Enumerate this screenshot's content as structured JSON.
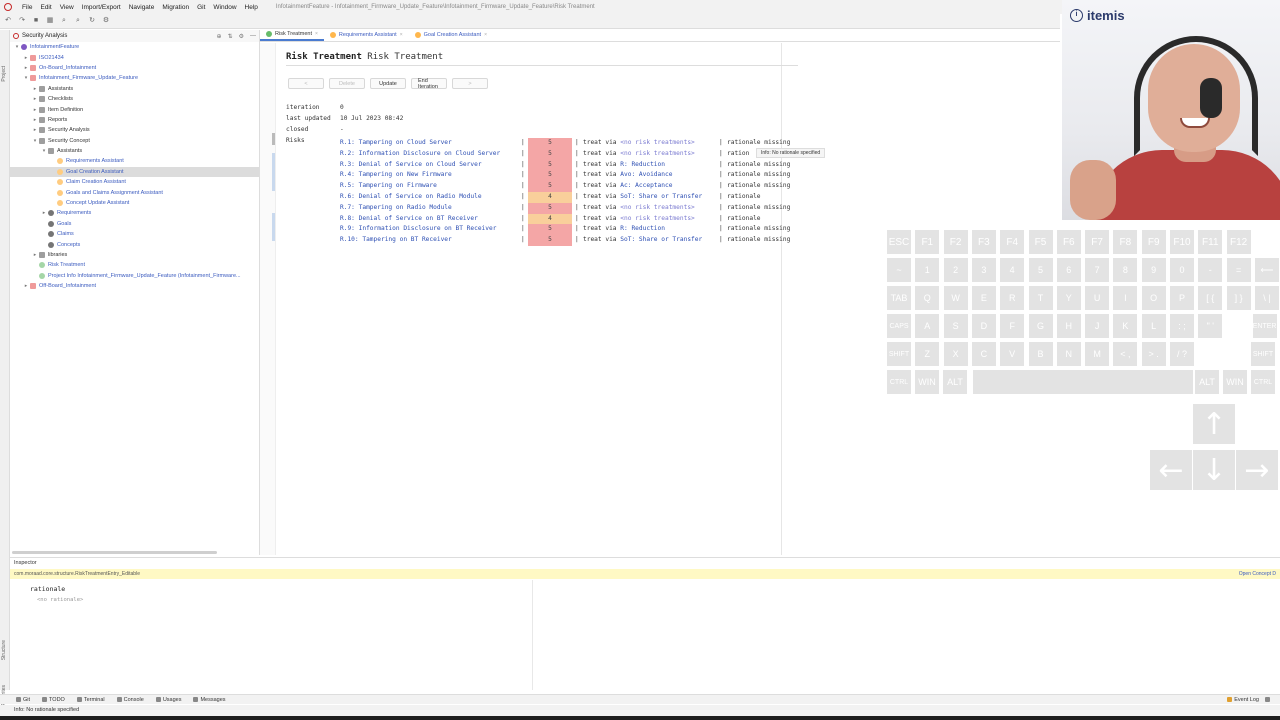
{
  "menu": {
    "items": [
      "File",
      "Edit",
      "View",
      "Import/Export",
      "Navigate",
      "Migration",
      "Git",
      "Window",
      "Help"
    ],
    "window_title": "InfotainmentFeature - Infotainment_Firmware_Update_Feature\\Infotainment_Firmware_Update_Feature\\Risk Treatment"
  },
  "project_panel": {
    "title": "Security Analysis",
    "tree": [
      {
        "label": "InfotainmentFeature",
        "depth": 0,
        "arrow": "▾",
        "icon": "model"
      },
      {
        "label": "ISO21434",
        "depth": 1,
        "arrow": "▸",
        "icon": "s"
      },
      {
        "label": "On-Board_Infotainment",
        "depth": 1,
        "arrow": "▸",
        "icon": "s"
      },
      {
        "label": "Infotainment_Firmware_Update_Feature",
        "depth": 1,
        "arrow": "▾",
        "icon": "s"
      },
      {
        "label": "Assistants",
        "depth": 2,
        "arrow": "▸",
        "icon": "folder"
      },
      {
        "label": "Checklists",
        "depth": 2,
        "arrow": "▸",
        "icon": "folder"
      },
      {
        "label": "Item Definition",
        "depth": 2,
        "arrow": "▸",
        "icon": "folder"
      },
      {
        "label": "Reports",
        "depth": 2,
        "arrow": "▸",
        "icon": "folder"
      },
      {
        "label": "Security Analysis",
        "depth": 2,
        "arrow": "▸",
        "icon": "folder"
      },
      {
        "label": "Security Concept",
        "depth": 2,
        "arrow": "▾",
        "icon": "folder"
      },
      {
        "label": "Assistants",
        "depth": 3,
        "arrow": "▾",
        "icon": "folder"
      },
      {
        "label": "Requirements Assistant",
        "depth": 4,
        "arrow": "",
        "icon": "a"
      },
      {
        "label": "Goal Creation Assistant",
        "depth": 4,
        "arrow": "",
        "icon": "a",
        "selected": true
      },
      {
        "label": "Claim Creation Assistant",
        "depth": 4,
        "arrow": "",
        "icon": "a"
      },
      {
        "label": "Goals and Claims Assignment Assistant",
        "depth": 4,
        "arrow": "",
        "icon": "a"
      },
      {
        "label": "Concept Update Assistant",
        "depth": 4,
        "arrow": "",
        "icon": "a"
      },
      {
        "label": "Requirements",
        "depth": 3,
        "arrow": "▸",
        "icon": "g"
      },
      {
        "label": "Goals",
        "depth": 3,
        "arrow": "",
        "icon": "g"
      },
      {
        "label": "Claims",
        "depth": 3,
        "arrow": "",
        "icon": "g"
      },
      {
        "label": "Concepts",
        "depth": 3,
        "arrow": "",
        "icon": "g"
      },
      {
        "label": "libraries",
        "depth": 2,
        "arrow": "▸",
        "icon": "folder"
      },
      {
        "label": "Risk Treatment",
        "depth": 2,
        "arrow": "",
        "icon": "r"
      },
      {
        "label": "Project Info Infotainment_Firmware_Update_Feature (Infotainment_Firmware...",
        "depth": 2,
        "arrow": "",
        "icon": "r"
      },
      {
        "label": "Off-Board_Infotainment",
        "depth": 1,
        "arrow": "▸",
        "icon": "s"
      }
    ]
  },
  "editor_tabs": [
    {
      "label": "Risk Treatment",
      "active": true,
      "color": "#66bb6a"
    },
    {
      "label": "Requirements Assistant",
      "active": false,
      "color": "#ffb74d"
    },
    {
      "label": "Goal Creation Assistant",
      "active": false,
      "color": "#ffb74d"
    }
  ],
  "document": {
    "keyword": "Risk Treatment",
    "name": "Risk Treatment",
    "buttons": [
      {
        "label": "<",
        "disabled": true
      },
      {
        "label": "Delete",
        "disabled": true
      },
      {
        "label": "Update",
        "disabled": false
      },
      {
        "label": "End Iteration",
        "disabled": false
      },
      {
        "label": ">",
        "disabled": true
      }
    ],
    "properties": [
      {
        "key": "iteration",
        "value": "0"
      },
      {
        "key": "last updated",
        "value": "10 Jul 2023 08:42"
      },
      {
        "key": "closed",
        "value": "-"
      }
    ],
    "risks_label": "Risks",
    "risks": [
      {
        "id": "R.1: Tampering on Cloud Server",
        "score": "5",
        "level": "high",
        "treat_prefix": "treat via",
        "treatment": "<no risk treatments>",
        "none": true,
        "rationale": "rationale missing"
      },
      {
        "id": "R.2: Information Disclosure on Cloud Server",
        "score": "5",
        "level": "high",
        "treat_prefix": "treat via",
        "treatment": "<no risk treatments>",
        "none": true,
        "rationale": "ration"
      },
      {
        "id": "R.3: Denial of Service on Cloud Server",
        "score": "5",
        "level": "high",
        "treat_prefix": "treat via",
        "treatment": "R: Reduction",
        "none": false,
        "rationale": "rationale missing"
      },
      {
        "id": "R.4: Tampering on New Firmware",
        "score": "5",
        "level": "high",
        "treat_prefix": "treat via",
        "treatment": "Avo: Avoidance",
        "none": false,
        "rationale": "rationale missing"
      },
      {
        "id": "R.5: Tampering on Firmware",
        "score": "5",
        "level": "high",
        "treat_prefix": "treat via",
        "treatment": "Ac: Acceptance",
        "none": false,
        "rationale": "rationale missing"
      },
      {
        "id": "R.6: Denial of Service on Radio Module",
        "score": "4",
        "level": "mid",
        "treat_prefix": "treat via",
        "treatment": "SoT: Share or Transfer",
        "none": false,
        "rationale": "rationale"
      },
      {
        "id": "R.7: Tampering on Radio Module",
        "score": "5",
        "level": "high",
        "treat_prefix": "treat via",
        "treatment": "<no risk treatments>",
        "none": true,
        "rationale": "rationale missing"
      },
      {
        "id": "R.8: Denial of Service on BT Receiver",
        "score": "4",
        "level": "mid",
        "treat_prefix": "treat via",
        "treatment": "<no risk treatments>",
        "none": true,
        "rationale": "rationale"
      },
      {
        "id": "R.9: Information Disclosure on BT Receiver",
        "score": "5",
        "level": "high",
        "treat_prefix": "treat via",
        "treatment": "R: Reduction",
        "none": false,
        "rationale": "rationale missing"
      },
      {
        "id": "R.10: Tampering on BT Receiver",
        "score": "5",
        "level": "high",
        "treat_prefix": "treat via",
        "treatment": "SoT: Share or Transfer",
        "none": false,
        "rationale": "rationale missing"
      }
    ],
    "tooltip": "Info: No rationale specified",
    "colors": {
      "high": "#f4a6a6",
      "mid": "#f9cf9b"
    }
  },
  "inspector": {
    "title": "Inspector",
    "path": "com.moraad.core.structure.RiskTreatmentEntry_Editable",
    "open_link": "Open Concept D",
    "label": "rationale",
    "value": "<no rationale>"
  },
  "bottom_tabs": [
    "Git",
    "TODO",
    "Terminal",
    "Console",
    "Usages",
    "Messages"
  ],
  "event_log": "Event Log",
  "status": "Info: No rationale specified",
  "strip_labels": {
    "project": "Project",
    "structure": "Structure",
    "favorites": "Favorites"
  },
  "webcam": {
    "brand": "itemis"
  },
  "keyboard": {
    "rows": [
      [
        "ESC",
        "F1",
        "F2",
        "F3",
        "F4",
        "F5",
        "F6",
        "F7",
        "F8",
        "F9",
        "F10",
        "F11",
        "F12"
      ],
      [
        "~",
        "1",
        "2",
        "3",
        "4",
        "5",
        "6",
        "7",
        "8",
        "9",
        "0",
        "-",
        "=",
        "⟵"
      ],
      [
        "TAB",
        "Q",
        "W",
        "E",
        "R",
        "T",
        "Y",
        "U",
        "I",
        "O",
        "P",
        "[ {",
        "] }",
        "\\ |"
      ],
      [
        "CAPS",
        "A",
        "S",
        "D",
        "F",
        "G",
        "H",
        "J",
        "K",
        "L",
        ": ;",
        "\" '",
        "ENTER"
      ],
      [
        "SHIFT",
        "Z",
        "X",
        "C",
        "V",
        "B",
        "N",
        "M",
        "< ,",
        "> .",
        "/ ?",
        "SHIFT"
      ],
      [
        "CTRL",
        "WIN",
        "ALT",
        "",
        "ALT",
        "WIN",
        "CTRL"
      ]
    ],
    "arrows": {
      "up": "↑",
      "left": "←",
      "down": "↓",
      "right": "→"
    }
  }
}
